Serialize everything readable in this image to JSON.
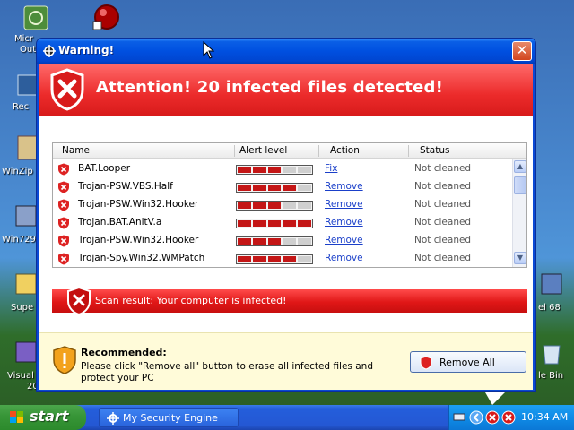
{
  "desktop": {
    "icons": [
      {
        "name": "micro-icon",
        "label": "Micr\nOut"
      },
      {
        "name": "recycle-icon",
        "label": ""
      }
    ],
    "labels": [
      "Micr",
      "Out",
      "Rec",
      "WinZip",
      "Win729",
      "Supe",
      "Visual",
      "20",
      "el 68",
      "le Bin"
    ]
  },
  "window": {
    "title": "Warning!",
    "close_glyph": "✕",
    "banner_title": "Attention! 20 infected files detected!",
    "table": {
      "headers": [
        "Name",
        "Alert level",
        "Action",
        "Status"
      ],
      "rows": [
        {
          "name": "BAT.Looper",
          "level": 3,
          "action": "Fix",
          "status": "Not cleaned"
        },
        {
          "name": "Trojan-PSW.VBS.Half",
          "level": 4,
          "action": "Remove",
          "status": "Not cleaned"
        },
        {
          "name": "Trojan-PSW.Win32.Hooker",
          "level": 3,
          "action": "Remove",
          "status": "Not cleaned"
        },
        {
          "name": "Trojan.BAT.AnitV.a",
          "level": 5,
          "action": "Remove",
          "status": "Not cleaned"
        },
        {
          "name": "Trojan-PSW.Win32.Hooker",
          "level": 3,
          "action": "Remove",
          "status": "Not cleaned"
        },
        {
          "name": "Trojan-Spy.Win32.WMPatch",
          "level": 4,
          "action": "Remove",
          "status": "Not cleaned"
        }
      ],
      "meter_segments": 5
    },
    "scan_result": "Scan result: Your computer is infected!",
    "recommend": {
      "title": "Recommended:",
      "text": "Please click \"Remove all\" button to erase all infected files and protect your PC",
      "button": "Remove All"
    }
  },
  "taskbar": {
    "start_label": "start",
    "task_label": "My Security Engine",
    "clock": "10:34 AM"
  },
  "colors": {
    "alert_red": "#e01717",
    "xp_blue": "#0a49d4",
    "link_blue": "#1a3fc9"
  }
}
